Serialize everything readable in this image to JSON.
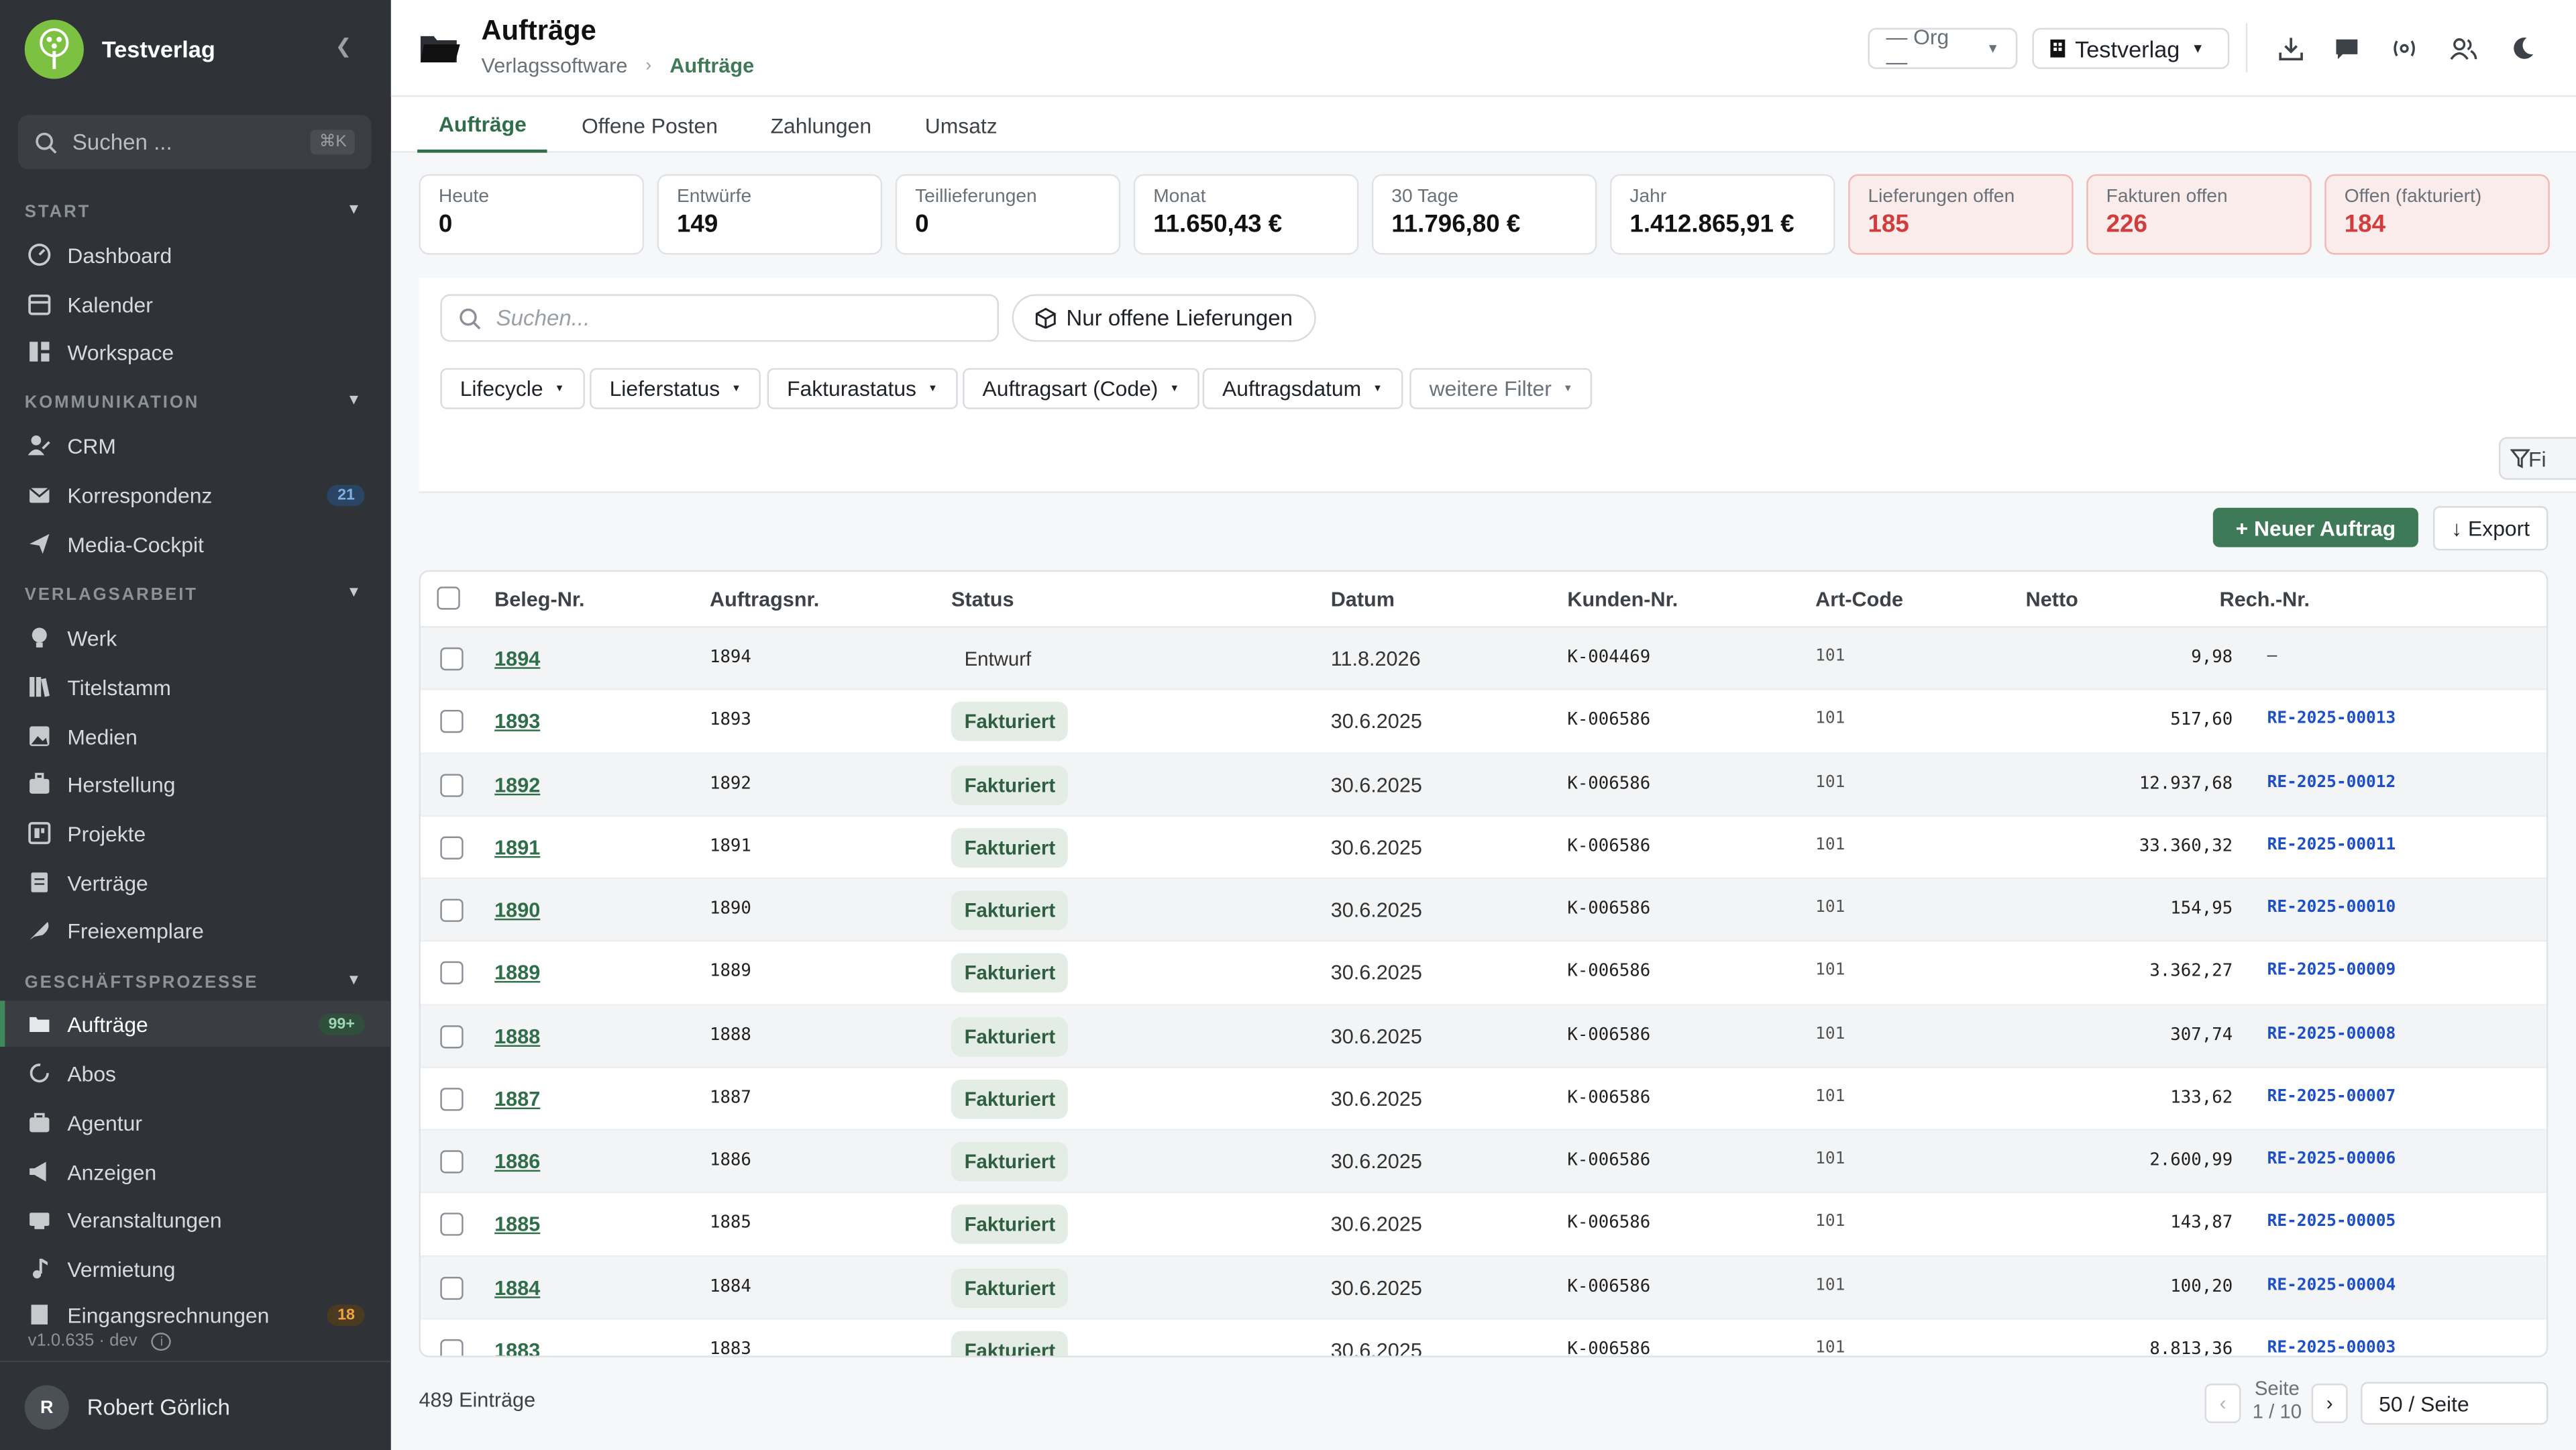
{
  "sidebar": {
    "brand": "Testverlag",
    "search_placeholder": "Suchen ...",
    "search_shortcut": "⌘K",
    "sections": [
      {
        "title": "START",
        "items": [
          {
            "label": "Dashboard",
            "icon": "dashboard-icon"
          },
          {
            "label": "Kalender",
            "icon": "calendar-icon"
          },
          {
            "label": "Workspace",
            "icon": "workspace-icon"
          }
        ]
      },
      {
        "title": "KOMMUNIKATION",
        "items": [
          {
            "label": "CRM",
            "icon": "crm-icon"
          },
          {
            "label": "Korrespondenz",
            "icon": "mail-icon",
            "badge": "21"
          },
          {
            "label": "Media-Cockpit",
            "icon": "send-icon"
          }
        ]
      },
      {
        "title": "VERLAGSARBEIT",
        "items": [
          {
            "label": "Werk",
            "icon": "bulb-icon"
          },
          {
            "label": "Titelstamm",
            "icon": "books-icon"
          },
          {
            "label": "Medien",
            "icon": "image-icon"
          },
          {
            "label": "Herstellung",
            "icon": "briefcase-icon"
          },
          {
            "label": "Projekte",
            "icon": "project-icon"
          },
          {
            "label": "Verträge",
            "icon": "contract-icon"
          },
          {
            "label": "Freiexemplare",
            "icon": "feather-icon"
          }
        ]
      },
      {
        "title": "GESCHÄFTSPROZESSE",
        "items": [
          {
            "label": "Aufträge",
            "icon": "folder-icon",
            "badge": "99+",
            "active": true
          },
          {
            "label": "Abos",
            "icon": "refresh-icon"
          },
          {
            "label": "Agentur",
            "icon": "bag-icon"
          },
          {
            "label": "Anzeigen",
            "icon": "megaphone-icon"
          },
          {
            "label": "Veranstaltungen",
            "icon": "event-icon"
          },
          {
            "label": "Vermietung",
            "icon": "music-icon"
          },
          {
            "label": "Eingangsrechnungen",
            "icon": "invoice-icon",
            "badge": "18"
          }
        ]
      }
    ],
    "version": "v1.0.635 · dev",
    "user": {
      "initial": "R",
      "name": "Robert Görlich"
    }
  },
  "header": {
    "title": "Aufträge",
    "breadcrumb": [
      "Verlagssoftware",
      "Aufträge"
    ],
    "org_select": "— Org —",
    "tenant_select": "Testverlag"
  },
  "tabs": [
    "Aufträge",
    "Offene Posten",
    "Zahlungen",
    "Umsatz"
  ],
  "kpis": [
    {
      "label": "Heute",
      "value": "0"
    },
    {
      "label": "Entwürfe",
      "value": "149"
    },
    {
      "label": "Teillieferungen",
      "value": "0"
    },
    {
      "label": "Monat",
      "value": "11.650,43 €"
    },
    {
      "label": "30 Tage",
      "value": "11.796,80 €"
    },
    {
      "label": "Jahr",
      "value": "1.412.865,91 €"
    },
    {
      "label": "Lieferungen offen",
      "value": "185",
      "alert": true
    },
    {
      "label": "Fakturen offen",
      "value": "226",
      "alert": true
    },
    {
      "label": "Offen (fakturiert)",
      "value": "184",
      "alert": true
    }
  ],
  "filters": {
    "search_placeholder": "Suchen...",
    "open_deliveries": "Nur offene Lieferungen",
    "chips": [
      "Lifecycle",
      "Lieferstatus",
      "Fakturastatus",
      "Auftragsart (Code)",
      "Auftragsdatum",
      "weitere Filter"
    ],
    "filter_button": "Fi"
  },
  "actions": {
    "new_order": "+ Neuer Auftrag",
    "export": "↓ Export"
  },
  "table": {
    "columns": [
      "Beleg-Nr.",
      "Auftragsnr.",
      "Status",
      "Datum",
      "Kunden-Nr.",
      "Art-Code",
      "Netto",
      "Rech.-Nr."
    ],
    "rows": [
      {
        "beleg": "1894",
        "auftrag": "1894",
        "status": "Entwurf",
        "datum": "11.8.2026",
        "kunde": "K-004469",
        "art": "101",
        "netto": "9,98",
        "rech": "—"
      },
      {
        "beleg": "1893",
        "auftrag": "1893",
        "status": "Fakturiert",
        "datum": "30.6.2025",
        "kunde": "K-006586",
        "art": "101",
        "netto": "517,60",
        "rech": "RE-2025-00013"
      },
      {
        "beleg": "1892",
        "auftrag": "1892",
        "status": "Fakturiert",
        "datum": "30.6.2025",
        "kunde": "K-006586",
        "art": "101",
        "netto": "12.937,68",
        "rech": "RE-2025-00012"
      },
      {
        "beleg": "1891",
        "auftrag": "1891",
        "status": "Fakturiert",
        "datum": "30.6.2025",
        "kunde": "K-006586",
        "art": "101",
        "netto": "33.360,32",
        "rech": "RE-2025-00011"
      },
      {
        "beleg": "1890",
        "auftrag": "1890",
        "status": "Fakturiert",
        "datum": "30.6.2025",
        "kunde": "K-006586",
        "art": "101",
        "netto": "154,95",
        "rech": "RE-2025-00010"
      },
      {
        "beleg": "1889",
        "auftrag": "1889",
        "status": "Fakturiert",
        "datum": "30.6.2025",
        "kunde": "K-006586",
        "art": "101",
        "netto": "3.362,27",
        "rech": "RE-2025-00009"
      },
      {
        "beleg": "1888",
        "auftrag": "1888",
        "status": "Fakturiert",
        "datum": "30.6.2025",
        "kunde": "K-006586",
        "art": "101",
        "netto": "307,74",
        "rech": "RE-2025-00008"
      },
      {
        "beleg": "1887",
        "auftrag": "1887",
        "status": "Fakturiert",
        "datum": "30.6.2025",
        "kunde": "K-006586",
        "art": "101",
        "netto": "133,62",
        "rech": "RE-2025-00007"
      },
      {
        "beleg": "1886",
        "auftrag": "1886",
        "status": "Fakturiert",
        "datum": "30.6.2025",
        "kunde": "K-006586",
        "art": "101",
        "netto": "2.600,99",
        "rech": "RE-2025-00006"
      },
      {
        "beleg": "1885",
        "auftrag": "1885",
        "status": "Fakturiert",
        "datum": "30.6.2025",
        "kunde": "K-006586",
        "art": "101",
        "netto": "143,87",
        "rech": "RE-2025-00005"
      },
      {
        "beleg": "1884",
        "auftrag": "1884",
        "status": "Fakturiert",
        "datum": "30.6.2025",
        "kunde": "K-006586",
        "art": "101",
        "netto": "100,20",
        "rech": "RE-2025-00004"
      },
      {
        "beleg": "1883",
        "auftrag": "1883",
        "status": "Fakturiert",
        "datum": "30.6.2025",
        "kunde": "K-006586",
        "art": "101",
        "netto": "8.813,36",
        "rech": "RE-2025-00003"
      }
    ]
  },
  "footer": {
    "count": "489 Einträge",
    "page_label": "Seite",
    "page_value": "1 / 10",
    "page_size": "50 / Seite"
  },
  "colors": {
    "sidebar_bg": "#2f3236",
    "accent": "#3f7a58",
    "alert_bg": "#fbecec",
    "alert_text": "#d13c3c",
    "link_blue": "#1d4fc6"
  }
}
